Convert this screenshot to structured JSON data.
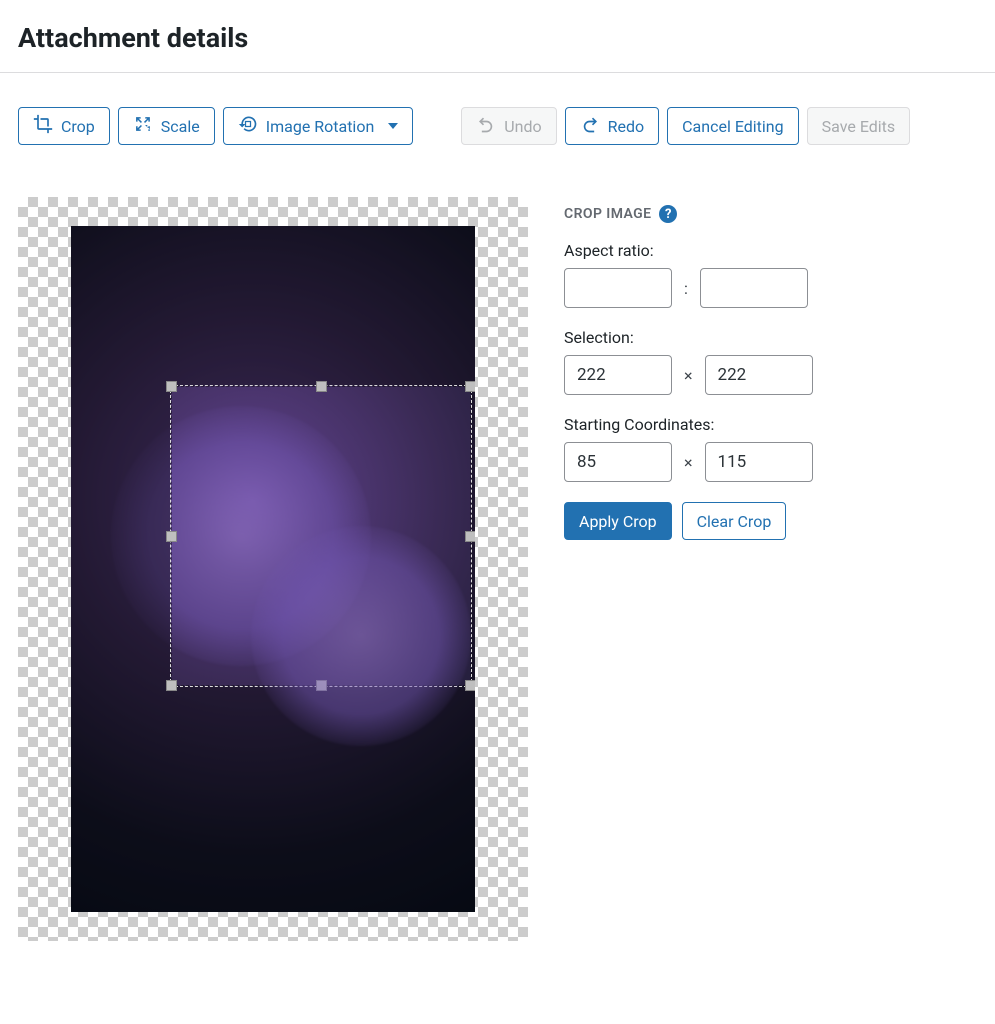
{
  "title": "Attachment details",
  "toolbar": {
    "crop": "Crop",
    "scale": "Scale",
    "rotate": "Image Rotation",
    "undo": "Undo",
    "redo": "Redo",
    "cancel": "Cancel Editing",
    "save": "Save Edits"
  },
  "crop_panel": {
    "heading": "CROP IMAGE",
    "aspect_label": "Aspect ratio:",
    "aspect_w": "",
    "aspect_h": "",
    "aspect_sep": ":",
    "selection_label": "Selection:",
    "sel_w": "222",
    "sel_h": "222",
    "times": "×",
    "coords_label": "Starting Coordinates:",
    "coord_x": "85",
    "coord_y": "115",
    "apply": "Apply Crop",
    "clear": "Clear Crop"
  }
}
